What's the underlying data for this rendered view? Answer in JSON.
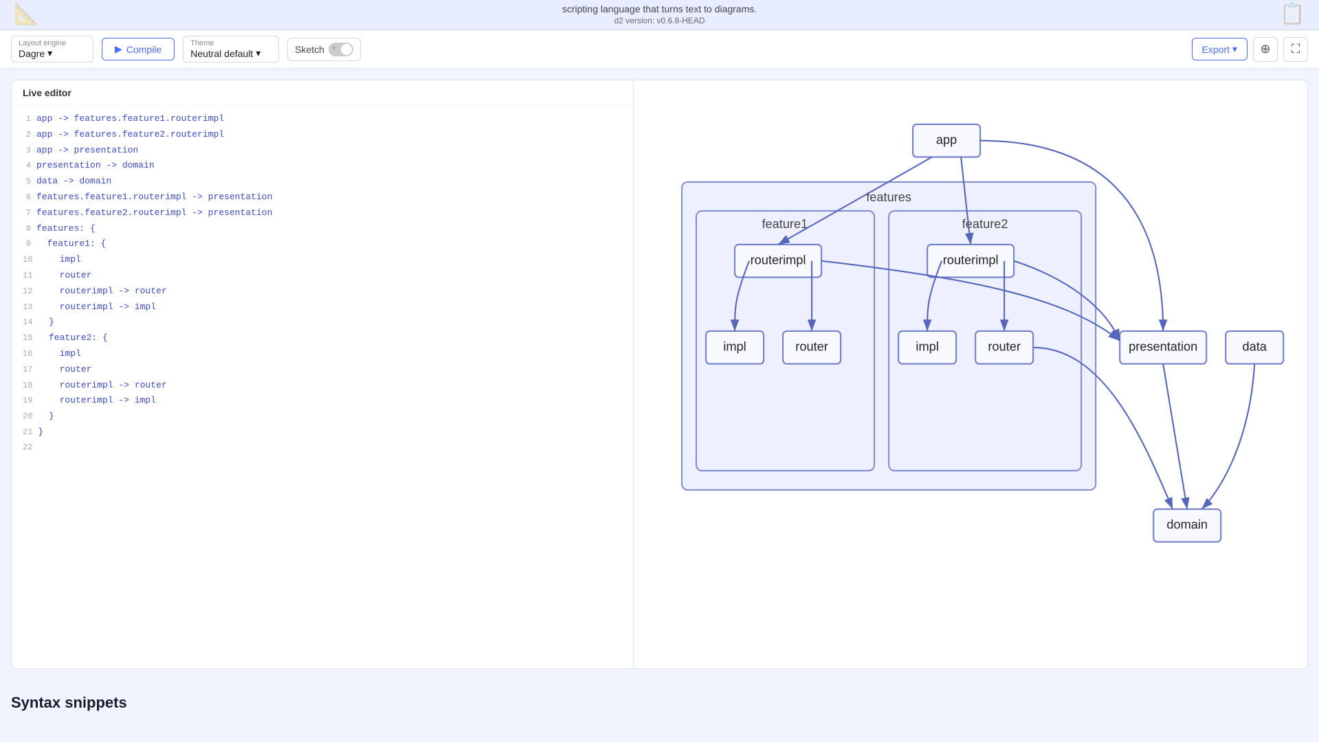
{
  "banner": {
    "text": "scripting language that turns text to diagrams.",
    "version": "d2 version: v0.6.8-HEAD"
  },
  "toolbar": {
    "layout_label": "Layout engine",
    "layout_value": "Dagre",
    "compile_label": "Compile",
    "theme_label": "Theme",
    "theme_value": "Neutral default",
    "sketch_label": "Sketch",
    "export_label": "Export"
  },
  "editor": {
    "title": "Live editor",
    "lines": [
      {
        "num": 1,
        "text": "app -> features.feature1.routerimpl"
      },
      {
        "num": 2,
        "text": "app -> features.feature2.routerimpl"
      },
      {
        "num": 3,
        "text": "app -> presentation"
      },
      {
        "num": 4,
        "text": "presentation -> domain"
      },
      {
        "num": 5,
        "text": "data -> domain"
      },
      {
        "num": 6,
        "text": "features.feature1.routerimpl -> presentation"
      },
      {
        "num": 7,
        "text": "features.feature2.routerimpl -> presentation"
      },
      {
        "num": 8,
        "text": "features: {"
      },
      {
        "num": 9,
        "text": "  feature1: {"
      },
      {
        "num": 10,
        "text": "    impl"
      },
      {
        "num": 11,
        "text": "    router"
      },
      {
        "num": 12,
        "text": "    routerimpl -> router"
      },
      {
        "num": 13,
        "text": "    routerimpl -> impl"
      },
      {
        "num": 14,
        "text": "  }"
      },
      {
        "num": 15,
        "text": "  feature2: {"
      },
      {
        "num": 16,
        "text": "    impl"
      },
      {
        "num": 17,
        "text": "    router"
      },
      {
        "num": 18,
        "text": "    routerimpl -> router"
      },
      {
        "num": 19,
        "text": "    routerimpl -> impl"
      },
      {
        "num": 20,
        "text": "  }"
      },
      {
        "num": 21,
        "text": "}"
      },
      {
        "num": 22,
        "text": ""
      }
    ]
  },
  "diagram": {
    "nodes": {
      "app": "app",
      "features": "features",
      "feature1": "feature1",
      "feature2": "feature2",
      "f1_routerimpl": "routerimpl",
      "f1_impl": "impl",
      "f1_router": "router",
      "f2_routerimpl": "routerimpl",
      "f2_impl": "impl",
      "f2_router": "router",
      "presentation": "presentation",
      "data": "data",
      "domain": "domain"
    }
  },
  "syntax": {
    "title": "Syntax snippets"
  },
  "icons": {
    "play": "▶",
    "chevron_down": "▾",
    "plus": "+",
    "fullscreen": "⛶",
    "x": "×"
  }
}
